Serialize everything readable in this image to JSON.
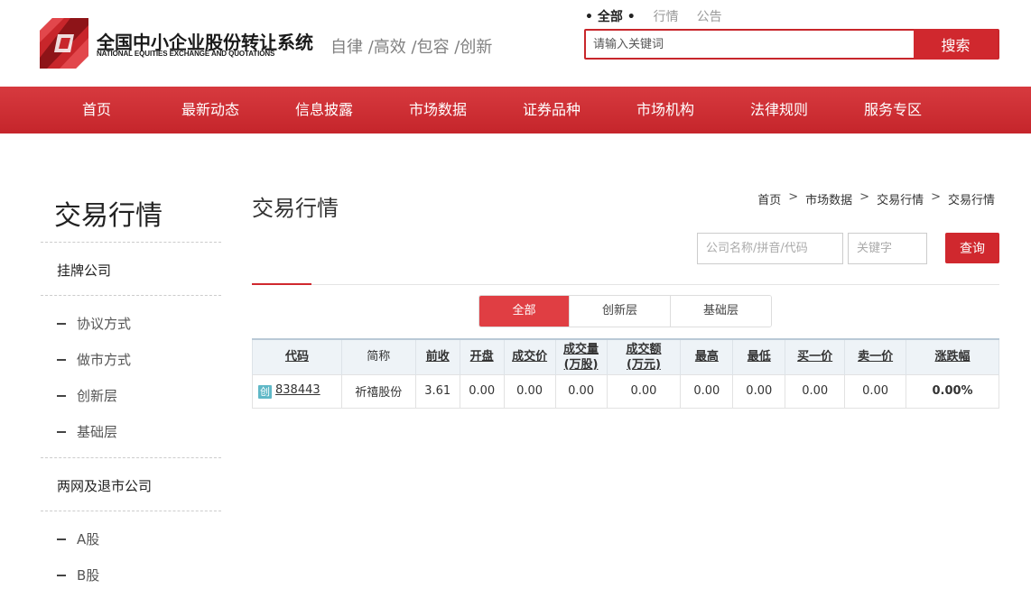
{
  "header": {
    "logo_cn": "全国中小企业股份转让系统",
    "logo_en": "NATIONAL EQUITIES EXCHANGE AND QUOTATIONS",
    "slogan": "自律 /高效 /包容 /创新",
    "search_tabs": [
      {
        "label": "• 全部 •",
        "active": true
      },
      {
        "label": "行情",
        "active": false
      },
      {
        "label": "公告",
        "active": false
      }
    ],
    "search_placeholder": "请输入关键词",
    "search_button": "搜索"
  },
  "nav": {
    "items": [
      "首页",
      "最新动态",
      "信息披露",
      "市场数据",
      "证券品种",
      "市场机构",
      "法律规则",
      "服务专区"
    ]
  },
  "sidebar": {
    "title": "交易行情",
    "groups": [
      {
        "label": "挂牌公司",
        "items": [
          "协议方式",
          "做市方式",
          "创新层",
          "基础层"
        ]
      },
      {
        "label": "两网及退市公司",
        "items": [
          "A股",
          "B股"
        ]
      }
    ]
  },
  "main": {
    "title": "交易行情",
    "breadcrumb": [
      "首页",
      "市场数据",
      "交易行情",
      "交易行情"
    ],
    "breadcrumb_sep": ">",
    "filter": {
      "company_placeholder": "公司名称/拼音/代码",
      "keyword_placeholder": "关键字",
      "query_button": "查询"
    },
    "layer_tabs": [
      {
        "label": "全部",
        "active": true
      },
      {
        "label": "创新层",
        "active": false
      },
      {
        "label": "基础层",
        "active": false
      }
    ],
    "table": {
      "columns": [
        {
          "label": "代码",
          "sortable": true
        },
        {
          "label": "简称",
          "sortable": false
        },
        {
          "label": "前收",
          "sortable": true
        },
        {
          "label": "开盘",
          "sortable": true
        },
        {
          "label": "成交价",
          "sortable": true
        },
        {
          "label": "成交量\n(万股)",
          "sortable": true
        },
        {
          "label": "成交额\n(万元)",
          "sortable": true
        },
        {
          "label": "最高",
          "sortable": true
        },
        {
          "label": "最低",
          "sortable": true
        },
        {
          "label": "买一价",
          "sortable": true
        },
        {
          "label": "卖一价",
          "sortable": true
        },
        {
          "label": "涨跌幅",
          "sortable": true
        }
      ],
      "rows": [
        {
          "badge": "创",
          "code": "838443",
          "name": "祈禧股份",
          "prev_close": "3.61",
          "open": "0.00",
          "price": "0.00",
          "volume": "0.00",
          "amount": "0.00",
          "high": "0.00",
          "low": "0.00",
          "bid1": "0.00",
          "ask1": "0.00",
          "change": "0.00%"
        }
      ]
    }
  },
  "colors": {
    "brand_red": "#d0282e",
    "tab_active": "#e03e43",
    "header_bg": "#eef3f7",
    "badge": "#5fb8c7"
  }
}
